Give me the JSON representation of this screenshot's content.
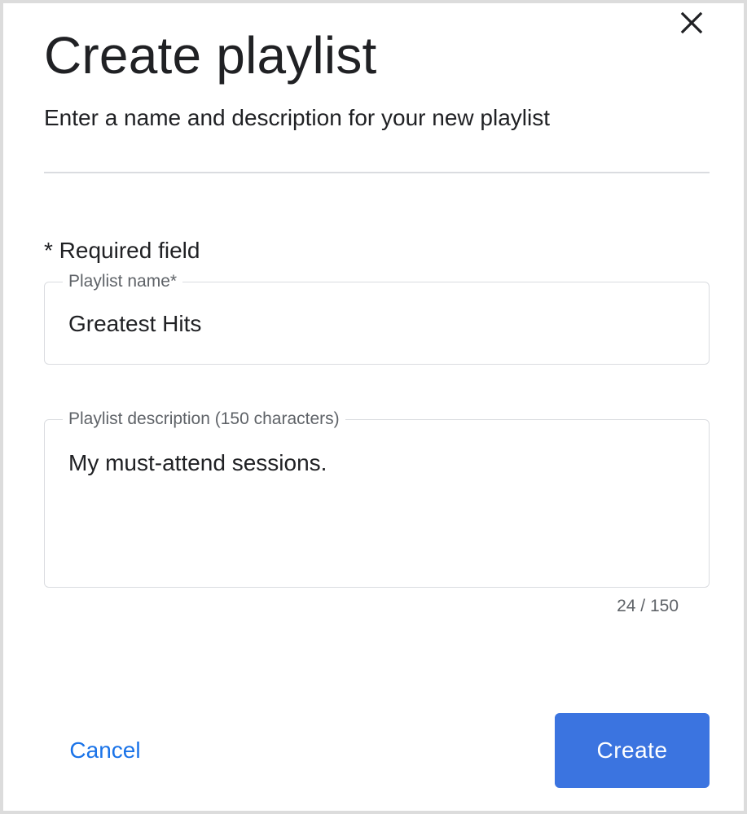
{
  "dialog": {
    "title": "Create playlist",
    "subtitle": "Enter a name and description for your new playlist",
    "close_icon": "close-icon"
  },
  "form": {
    "required_note": "* Required field",
    "name_field": {
      "label": "Playlist name*",
      "value": "Greatest Hits"
    },
    "description_field": {
      "label": "Playlist description (150 characters)",
      "value": "My must-attend sessions.",
      "counter": "24 / 150"
    }
  },
  "actions": {
    "cancel_label": "Cancel",
    "create_label": "Create"
  },
  "colors": {
    "accent": "#1a73e8",
    "primary_button": "#3b74e0",
    "border": "#dadce0",
    "label_text": "#5f6368",
    "body_text": "#202124"
  }
}
